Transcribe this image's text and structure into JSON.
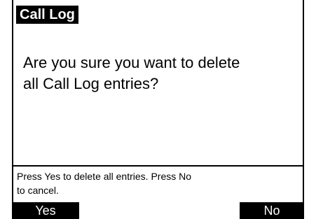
{
  "title": "Call Log",
  "message": "Are you sure you want to delete\nall Call Log entries?",
  "hint": "Press Yes to delete all entries. Press No\nto cancel.",
  "softkeys": {
    "left": "Yes",
    "right": "No"
  }
}
